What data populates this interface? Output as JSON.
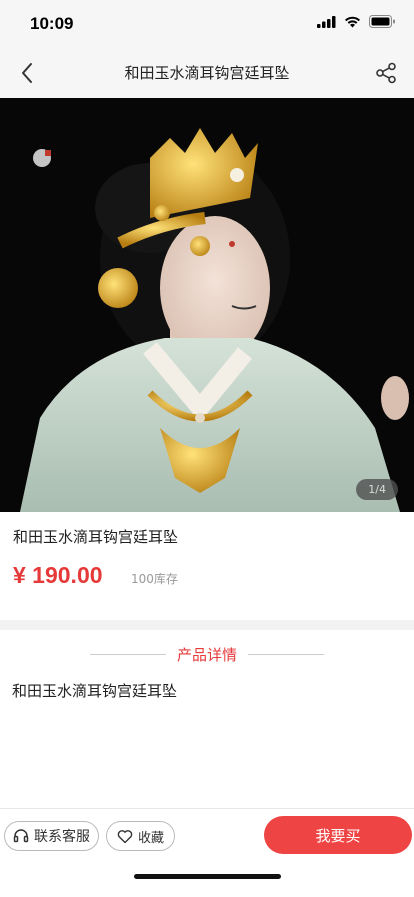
{
  "status_bar": {
    "time": "10:09"
  },
  "nav": {
    "title": "和田玉水滴耳钩宫廷耳坠"
  },
  "gallery": {
    "indicator": "1/4"
  },
  "product": {
    "title": "和田玉水滴耳钩宫廷耳坠",
    "price": "¥ 190.00",
    "stock": "100库存"
  },
  "details": {
    "heading": "产品详情",
    "text": "和田玉水滴耳钩宫廷耳坠"
  },
  "bottom": {
    "service_label": "联系客服",
    "favorite_label": "收藏",
    "buy_label": "我要买"
  },
  "colors": {
    "accent": "#ef4444",
    "price": "#e63a3a"
  }
}
